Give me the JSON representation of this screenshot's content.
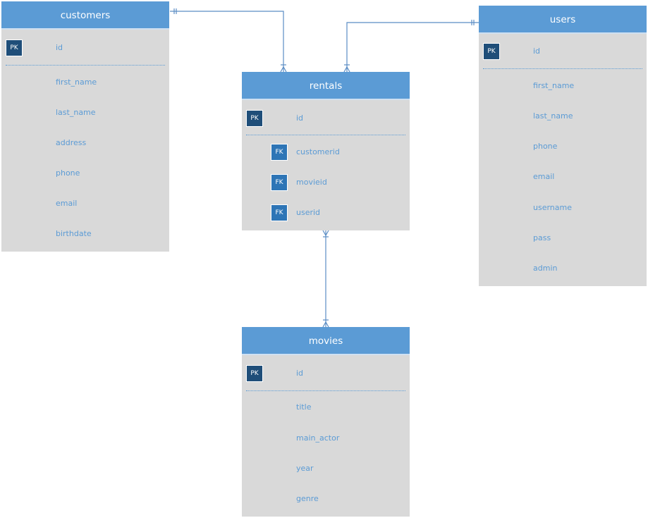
{
  "diagram": {
    "type": "entity-relationship",
    "colors": {
      "header": "#5b9bd5",
      "body": "#d9d9d9",
      "field_text": "#5b9bd5",
      "pk_badge": "#1f4e79",
      "fk_badge": "#2e75b6",
      "connector": "#5b8dc4"
    },
    "badges": {
      "pk": "PK",
      "fk": "FK"
    }
  },
  "entities": {
    "customers": {
      "title": "customers",
      "pk": "id",
      "fields": [
        "first_name",
        "last_name",
        "address",
        "phone",
        "email",
        "birthdate"
      ]
    },
    "rentals": {
      "title": "rentals",
      "pk": "id",
      "fk_fields": [
        "customerid",
        "movieid",
        "userid"
      ]
    },
    "users": {
      "title": "users",
      "pk": "id",
      "fields": [
        "first_name",
        "last_name",
        "phone",
        "email",
        "username",
        "pass",
        "admin"
      ]
    },
    "movies": {
      "title": "movies",
      "pk": "id",
      "fields": [
        "title",
        "main_actor",
        "year",
        "genre"
      ]
    }
  },
  "relationships": [
    {
      "from": "customers",
      "to": "rentals",
      "from_cardinality": "one-and-only-one",
      "to_cardinality": "one-or-many"
    },
    {
      "from": "users",
      "to": "rentals",
      "from_cardinality": "one-and-only-one",
      "to_cardinality": "one-or-many"
    },
    {
      "from": "rentals",
      "to": "movies",
      "from_cardinality": "one-or-many",
      "to_cardinality": "one-or-many"
    }
  ]
}
